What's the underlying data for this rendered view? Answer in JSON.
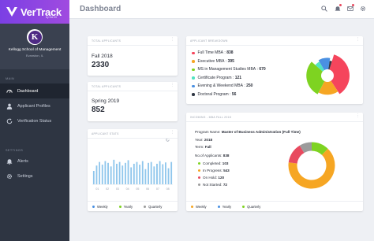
{
  "brand": {
    "name": "VerTrack",
    "sub": "by the ID"
  },
  "school": {
    "initial": "K",
    "name": "Kellogg School of Management",
    "location": "Evanston, IL"
  },
  "nav": {
    "main_label": "MAIN",
    "items": [
      {
        "label": "Dashboard",
        "icon": "gauge-icon"
      },
      {
        "label": "Applicant Profiles",
        "icon": "user-icon"
      },
      {
        "label": "Verification Status",
        "icon": "refresh-icon"
      }
    ],
    "settings_label": "SETTINGS",
    "settings_items": [
      {
        "label": "Alerts",
        "icon": "bell-icon"
      },
      {
        "label": "Settings",
        "icon": "gear-icon"
      }
    ]
  },
  "topbar": {
    "title": "Dashboard"
  },
  "total_applicants": {
    "title": "TOTAL APPLICANTS",
    "term": "Fall 2018",
    "value": "2330"
  },
  "total_applicants_2": {
    "title": "TOTAL APPLICANTS",
    "term": "Spring 2019",
    "value": "852"
  },
  "breakdown": {
    "title": "APPLICANT BREAKDOWN",
    "items": [
      {
        "label": "Full Time MBA",
        "value": "838",
        "color": "#f5455c"
      },
      {
        "label": "Executive MBA",
        "value": "395",
        "color": "#f6a623"
      },
      {
        "label": "MS in Management Studies MBA",
        "value": "670",
        "color": "#7ed321"
      },
      {
        "label": "Certificate Program",
        "value": "121",
        "color": "#50e3c2"
      },
      {
        "label": "Evening & Weekend MBA",
        "value": "250",
        "color": "#4a90e2"
      },
      {
        "label": "Doctoral Program",
        "value": "56",
        "color": "#2e3542"
      }
    ]
  },
  "chart_data": {
    "type": "bar",
    "title": "APPLICANT STATS",
    "x_ticks": [
      "01",
      "02",
      "03",
      "04",
      "05",
      "06",
      "07",
      "08"
    ],
    "values": [
      30,
      42,
      50,
      44,
      52,
      48,
      40,
      55,
      46,
      50,
      42,
      48,
      54,
      38,
      46,
      50,
      44,
      52,
      34,
      48,
      50,
      40,
      46,
      52,
      45,
      49,
      36,
      50
    ],
    "bar_color": "#8fc6ec",
    "grid": false,
    "legend": [
      {
        "label": "Weekly",
        "color": "#4a90e2"
      },
      {
        "label": "Yearly",
        "color": "#7ed321"
      },
      {
        "label": "Quarterly",
        "color": "#9b9b9b"
      }
    ]
  },
  "incoming": {
    "title": "INCOMING - MBA FALL 2018",
    "program_label": "Program Name:",
    "program_value": "Master of Business Administration (Full Time)",
    "year_label": "Year:",
    "year_value": "2018",
    "term_label": "Term:",
    "term_value": "Fall",
    "count_label": "No.of Applicants:",
    "count_value": "838",
    "statuses": [
      {
        "label": "Completed",
        "value": "103",
        "color": "#7ed321"
      },
      {
        "label": "In Progress",
        "value": "543",
        "color": "#f6a623"
      },
      {
        "label": "On Hold",
        "value": "120",
        "color": "#e84a5f"
      },
      {
        "label": "Not Started",
        "value": "72",
        "color": "#9b9b9b"
      }
    ],
    "legend": [
      {
        "label": "Weekly",
        "color": "#f6a623"
      },
      {
        "label": "Yearly",
        "color": "#4a90e2"
      },
      {
        "label": "Quarterly",
        "color": "#7ed321"
      }
    ]
  }
}
